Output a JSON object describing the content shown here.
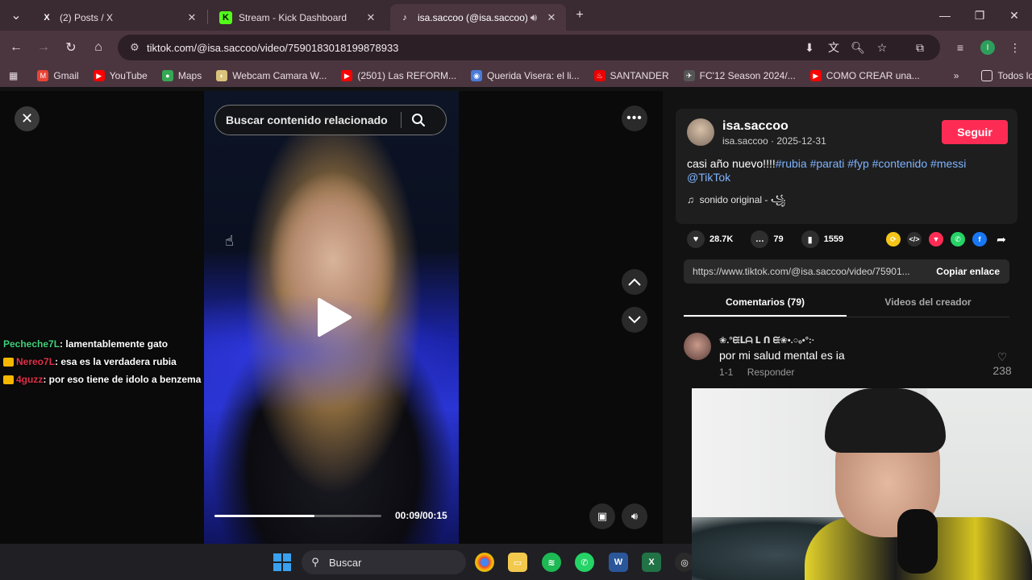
{
  "tabs": [
    {
      "title": "(2) Posts / X",
      "icon": "x-logo-icon"
    },
    {
      "title": "Stream - Kick Dashboard",
      "icon": "kick-logo-icon"
    },
    {
      "title": "isa.saccoo (@isa.saccoo) | T",
      "icon": "tiktok-logo-icon",
      "active": true
    }
  ],
  "address": {
    "url": "tiktok.com/@isa.saccoo/video/7590183018199878933"
  },
  "profile_initial": "I",
  "bookmarks": [
    {
      "label": "Gmail",
      "color": "#ea4335"
    },
    {
      "label": "YouTube",
      "color": "#ff0000"
    },
    {
      "label": "Maps",
      "color": "#34a853"
    },
    {
      "label": "Webcam Camara W...",
      "color": "#d9c27a"
    },
    {
      "label": "(2501) Las REFORM...",
      "color": "#ff0000"
    },
    {
      "label": "Querida Visera: el li...",
      "color": "#4a7bd8"
    },
    {
      "label": "SANTANDER",
      "color": "#ec0000"
    },
    {
      "label": "FC'12 Season 2024/...",
      "color": "#888888"
    },
    {
      "label": "COMO CREAR una...",
      "color": "#ff0000"
    }
  ],
  "bookmarks_more": "»",
  "bookmarks_all": "Todos los favoritos",
  "video": {
    "search_placeholder": "Buscar contenido relacionado",
    "current_time": "00:09",
    "duration": "00:15",
    "time_label": "00:09/00:15",
    "progress_fraction": 0.6
  },
  "chat": [
    {
      "user": "Pecheche7L",
      "user_color": "#3fd17a",
      "badge": false,
      "message": ": lamentablemente gato"
    },
    {
      "user": "Nereo7L",
      "user_color": "#e0304a",
      "badge": true,
      "message": ": esa es la verdadera rubia"
    },
    {
      "user": "4guzz",
      "user_color": "#e0304a",
      "badge": true,
      "message": ": por eso tiene de idolo a benzema"
    }
  ],
  "creator": {
    "handle": "isa.saccoo",
    "subline": "isa.saccoo · 2025-12-31",
    "follow_label": "Seguir",
    "caption_text": "casi año nuevo!!!!",
    "hashtags": [
      "#rubia",
      "#parati",
      "#fyp",
      "#contenido",
      "#messi"
    ],
    "mention": "@TikTok",
    "sound": "sonido original - ꧁"
  },
  "stats": {
    "likes": "28.7K",
    "comments": "79",
    "saves": "1559"
  },
  "link": {
    "text": "https://www.tiktok.com/@isa.saccoo/video/75901...",
    "copy_label": "Copiar enlace"
  },
  "panel_tabs": {
    "comments": "Comentarios (79)",
    "creator_videos": "Videos del creador"
  },
  "comment": {
    "user": "❀.°ᙓᒪᗩ ᒪ ᑎ ᙓ❀•.○ₒ•°:·",
    "text": "por mi salud mental es ia",
    "date": "1-1",
    "reply": "Responder",
    "likes": "238"
  },
  "taskbar": {
    "search_label": "Buscar"
  }
}
